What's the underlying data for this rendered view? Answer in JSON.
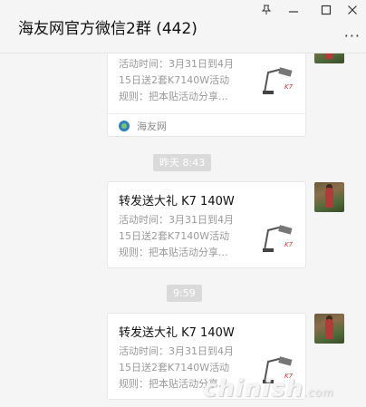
{
  "window": {
    "title": "海友网官方微信2群 (442)",
    "pin_icon": "pin-icon",
    "minimize_icon": "minimize-icon",
    "maximize_icon": "maximize-icon",
    "close_icon": "close-icon",
    "more_icon": "more-dots-icon"
  },
  "messages": [
    {
      "type": "card",
      "title": "",
      "desc_lines": [
        "活动时间：3月31日到4月",
        "15日送2套K7140W活动",
        "规则：把本贴活动分享..."
      ],
      "source": "海友网",
      "thumb_icon": "product-thumbnail-icon"
    },
    {
      "type": "time",
      "text": "昨天 8:43"
    },
    {
      "type": "card",
      "title": "转发送大礼 K7 140W",
      "desc_lines": [
        "活动时间：3月31日到4月",
        "15日送2套K7140W活动",
        "规则：把本贴活动分享..."
      ],
      "thumb_icon": "product-thumbnail-icon"
    },
    {
      "type": "time",
      "text": "9:59"
    },
    {
      "type": "card",
      "title": "转发送大礼 K7 140W",
      "desc_lines": [
        "活动时间：3月31日到4月",
        "15日送2套K7140W活动",
        "规则：把本贴活动分享..."
      ],
      "thumb_icon": "product-thumbnail-icon"
    }
  ],
  "watermark": {
    "text": "chinish",
    "suffix": ".com"
  }
}
